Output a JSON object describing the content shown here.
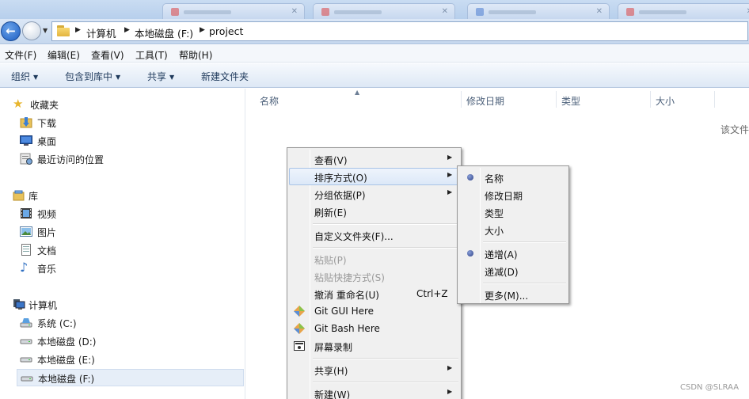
{
  "window": {
    "accent": "#1d5ec2"
  },
  "address": {
    "crumbs": [
      "计算机",
      "本地磁盘 (F:)",
      "project"
    ]
  },
  "menubar": {
    "items": [
      "文件(F)",
      "编辑(E)",
      "查看(V)",
      "工具(T)",
      "帮助(H)"
    ]
  },
  "toolbar": {
    "organize": "组织",
    "include_library": "包含到库中",
    "share": "共享",
    "new_folder": "新建文件夹"
  },
  "navpane": {
    "favorites": {
      "title": "收藏夹",
      "items": [
        "下载",
        "桌面",
        "最近访问的位置"
      ]
    },
    "libraries": {
      "title": "库",
      "items": [
        "视频",
        "图片",
        "文档",
        "音乐"
      ]
    },
    "computer": {
      "title": "计算机",
      "items": [
        "系统 (C:)",
        "本地磁盘 (D:)",
        "本地磁盘 (E:)",
        "本地磁盘 (F:)"
      ],
      "selected": "本地磁盘 (F:)"
    }
  },
  "columns": [
    "名称",
    "修改日期",
    "类型",
    "大小"
  ],
  "content": {
    "empty_message": "该文件"
  },
  "context_menu": {
    "view": "查看(V)",
    "sort_by": "排序方式(O)",
    "group_by": "分组依据(P)",
    "refresh": "刷新(E)",
    "customize_folder": "自定义文件夹(F)...",
    "paste": "粘贴(P)",
    "paste_shortcut": "粘贴快捷方式(S)",
    "undo_rename": "撤消 重命名(U)",
    "undo_shortcut": "Ctrl+Z",
    "git_gui": "Git GUI Here",
    "git_bash": "Git Bash Here",
    "screen_record": "屏幕录制",
    "share": "共享(H)",
    "new": "新建(W)"
  },
  "sort_submenu": {
    "name": "名称",
    "date_modified": "修改日期",
    "type": "类型",
    "size": "大小",
    "ascending": "递增(A)",
    "descending": "递减(D)",
    "more": "更多(M)...",
    "selected_field": "名称",
    "selected_order": "递增(A)"
  },
  "watermark": "CSDN @SLRAA"
}
